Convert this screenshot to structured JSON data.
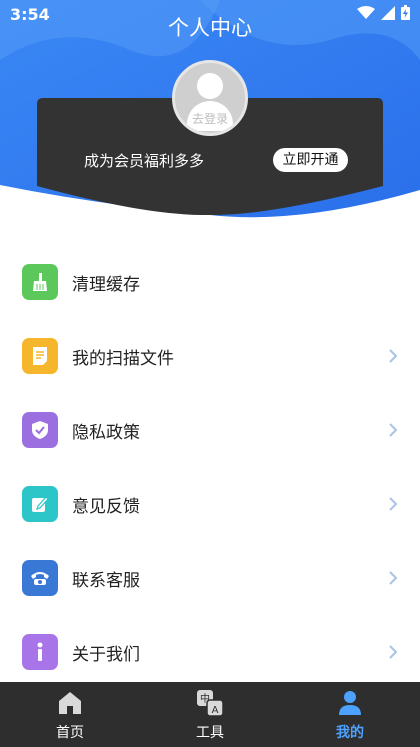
{
  "status_bar": {
    "time": "3:54"
  },
  "header": {
    "title": "个人中心"
  },
  "profile": {
    "login_text": "去登录"
  },
  "vip": {
    "text": "成为会员福利多多",
    "button": "立即开通"
  },
  "menu": [
    {
      "label": "清理缓存",
      "icon": "broom-icon",
      "color": "#5cc85c"
    },
    {
      "label": "我的扫描文件",
      "icon": "document-icon",
      "color": "#f5b62c"
    },
    {
      "label": "隐私政策",
      "icon": "shield-icon",
      "color": "#9b6fe0"
    },
    {
      "label": "意见反馈",
      "icon": "edit-icon",
      "color": "#2cc6c9"
    },
    {
      "label": "联系客服",
      "icon": "phone-icon",
      "color": "#3a78d6"
    },
    {
      "label": "关于我们",
      "icon": "info-icon",
      "color": "#a775e8"
    }
  ],
  "tabs": [
    {
      "label": "首页",
      "icon": "home-icon"
    },
    {
      "label": "工具",
      "icon": "translate-icon"
    },
    {
      "label": "我的",
      "icon": "user-icon"
    }
  ],
  "colors": {
    "header_blue": "#2f7bf2",
    "accent": "#4da1ff",
    "tabbar": "#2e2e2e",
    "card": "#333333"
  }
}
